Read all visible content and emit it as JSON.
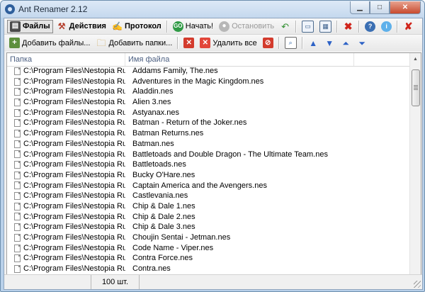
{
  "window": {
    "title": "Ant Renamer 2.12",
    "controls": [
      "minimize",
      "maximize",
      "close"
    ]
  },
  "toolbar_main": {
    "tab_files": "Файлы",
    "tab_actions": "Действия",
    "tab_log": "Протокол",
    "go_label": "Начать!",
    "stop_label": "Остановить",
    "icons": [
      "files-icon",
      "actions-icon",
      "log-icon",
      "go-icon",
      "stop-icon",
      "undo-icon",
      "window-icon",
      "window-grid-icon",
      "exit-icon",
      "help-icon",
      "about-icon"
    ]
  },
  "toolbar_files": {
    "add_files_label": "Добавить файлы...",
    "add_folders_label": "Добавить папки...",
    "remove_all_label": "Удалить все",
    "icons": [
      "add-files-icon",
      "add-folders-icon",
      "remove-selected-icon",
      "remove-all-icon",
      "remove-dead-icon",
      "preview-icon",
      "move-up-icon",
      "move-down-icon",
      "move-top-icon",
      "move-bottom-icon"
    ]
  },
  "file_list": {
    "columns": [
      "Папка",
      "Имя файла",
      ""
    ],
    "rows": [
      {
        "folder": "C:\\Program Files\\Nestopia Russi...",
        "name": "Addams Family, The.nes"
      },
      {
        "folder": "C:\\Program Files\\Nestopia Russi...",
        "name": "Adventures in the Magic Kingdom.nes"
      },
      {
        "folder": "C:\\Program Files\\Nestopia Russi...",
        "name": "Aladdin.nes"
      },
      {
        "folder": "C:\\Program Files\\Nestopia Russi...",
        "name": "Alien 3.nes"
      },
      {
        "folder": "C:\\Program Files\\Nestopia Russi...",
        "name": "Astyanax.nes"
      },
      {
        "folder": "C:\\Program Files\\Nestopia Russi...",
        "name": "Batman - Return of the Joker.nes"
      },
      {
        "folder": "C:\\Program Files\\Nestopia Russi...",
        "name": "Batman Returns.nes"
      },
      {
        "folder": "C:\\Program Files\\Nestopia Russi...",
        "name": "Batman.nes"
      },
      {
        "folder": "C:\\Program Files\\Nestopia Russi...",
        "name": "Battletoads and Double Dragon - The Ultimate Team.nes"
      },
      {
        "folder": "C:\\Program Files\\Nestopia Russi...",
        "name": "Battletoads.nes"
      },
      {
        "folder": "C:\\Program Files\\Nestopia Russi...",
        "name": "Bucky O'Hare.nes"
      },
      {
        "folder": "C:\\Program Files\\Nestopia Russi...",
        "name": "Captain America and the Avengers.nes"
      },
      {
        "folder": "C:\\Program Files\\Nestopia Russi...",
        "name": "Castlevania.nes"
      },
      {
        "folder": "C:\\Program Files\\Nestopia Russi...",
        "name": "Chip & Dale 1.nes"
      },
      {
        "folder": "C:\\Program Files\\Nestopia Russi...",
        "name": "Chip & Dale 2.nes"
      },
      {
        "folder": "C:\\Program Files\\Nestopia Russi...",
        "name": "Chip & Dale 3.nes"
      },
      {
        "folder": "C:\\Program Files\\Nestopia Russi...",
        "name": "Choujin Sentai - Jetman.nes"
      },
      {
        "folder": "C:\\Program Files\\Nestopia Russi...",
        "name": "Code Name - Viper.nes"
      },
      {
        "folder": "C:\\Program Files\\Nestopia Russi...",
        "name": "Contra Force.nes"
      },
      {
        "folder": "C:\\Program Files\\Nestopia Russi...",
        "name": "Contra.nes"
      }
    ]
  },
  "status_bar": {
    "count_text": "100 шт."
  },
  "colors": {
    "titlebar": "#c4d8ee",
    "header_text": "#4d6082",
    "go_green": "#2f9a45",
    "close_red": "#c84a2e",
    "arrow_blue": "#2d62c6"
  }
}
